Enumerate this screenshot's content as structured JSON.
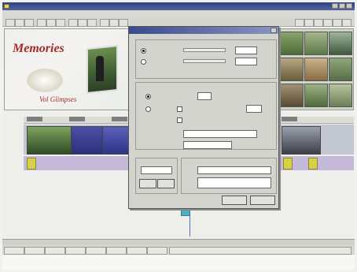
{
  "colors": {
    "titlebar": "#2d3e86",
    "preview_text": "#a52a2a",
    "video_track": "#c3c7cf",
    "fx_track": "#c5b9d9",
    "dialog_bg": "#d4d4ce"
  },
  "preview": {
    "title": "Memories",
    "subtitle": "Vol Glimpses"
  }
}
